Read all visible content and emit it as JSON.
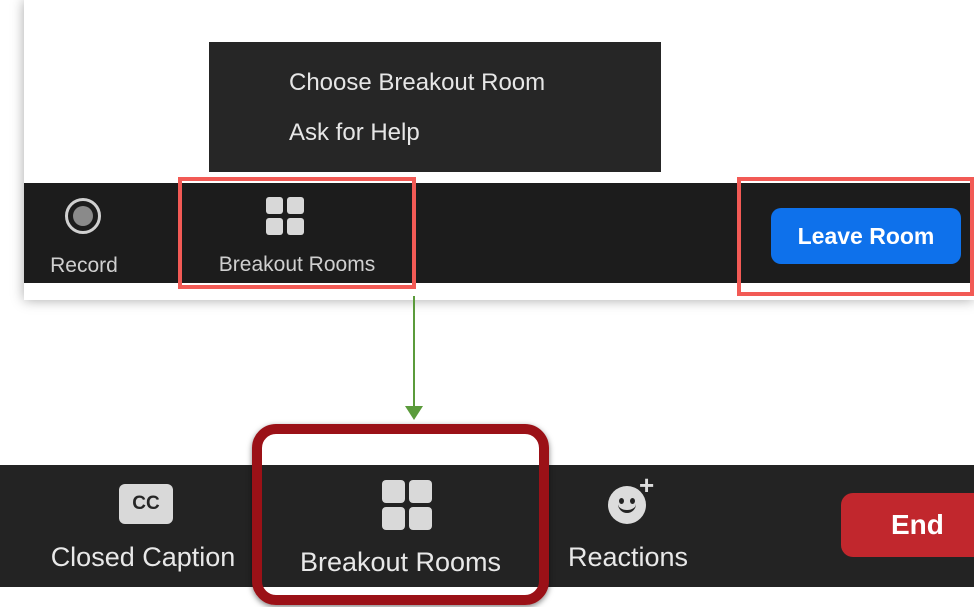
{
  "top_screenshot": {
    "popup_menu": {
      "items": [
        "Choose Breakout Room",
        "Ask for Help"
      ]
    },
    "toolbar": {
      "record_label": "Record",
      "breakout_label": "Breakout Rooms",
      "leave_label": "Leave Room"
    }
  },
  "bottom_toolbar": {
    "closed_caption_icon_text": "CC",
    "closed_caption_label": "Closed Caption",
    "breakout_label": "Breakout Rooms",
    "reactions_label": "Reactions",
    "reactions_plus": "+",
    "end_label": "End"
  },
  "icons": {
    "record": "record-icon",
    "breakout": "grid-icon",
    "closed_caption": "cc-icon",
    "reactions": "smiley-plus-icon",
    "arrow": "arrow-down-icon"
  },
  "colors": {
    "toolbar_bg": "#1c1c1c",
    "highlight_red": "#f25a55",
    "dark_red_outline": "#9b1117",
    "leave_blue": "#0e71eb",
    "end_red": "#c1272d",
    "arrow_green": "#5b9b3b"
  }
}
